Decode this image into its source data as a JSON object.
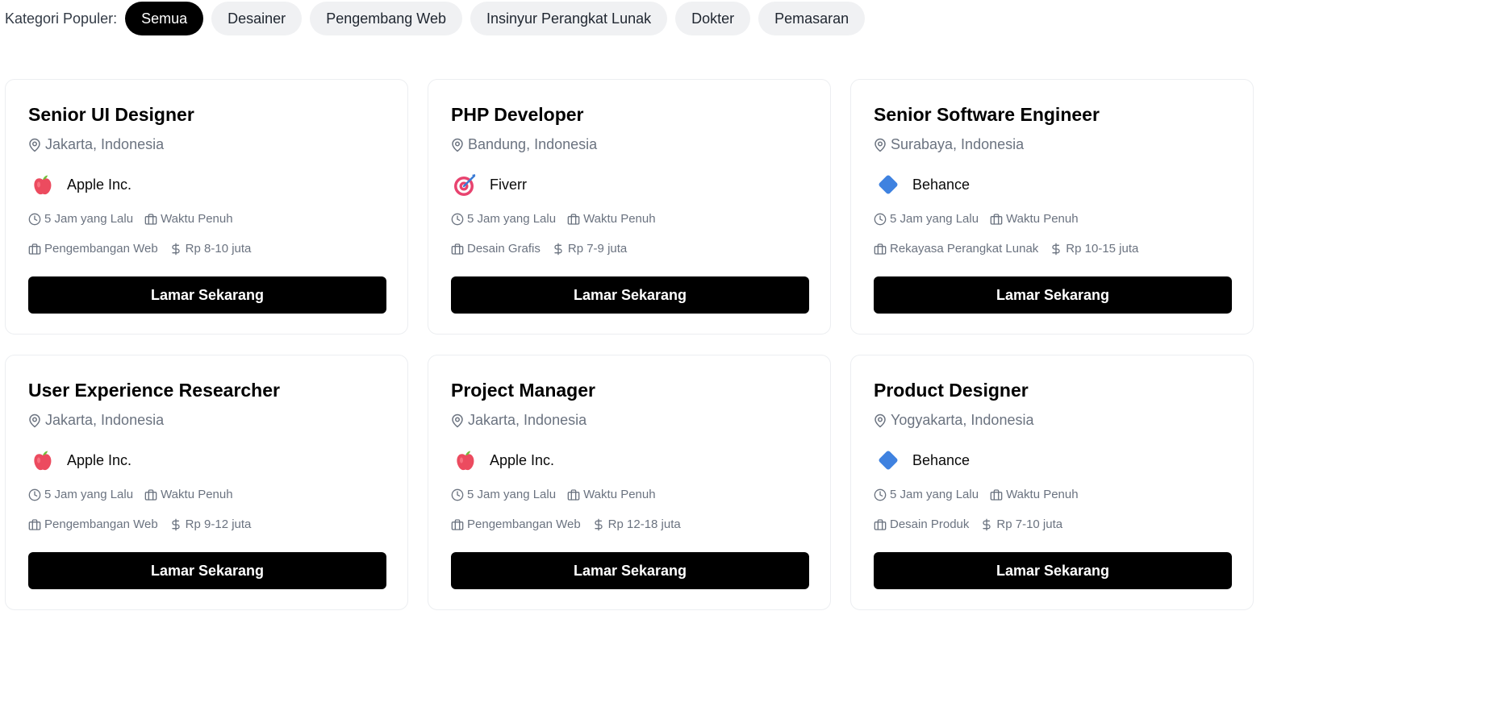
{
  "categories": {
    "label": "Kategori Populer:",
    "items": [
      "Semua",
      "Desainer",
      "Pengembang Web",
      "Insinyur Perangkat Lunak",
      "Dokter",
      "Pemasaran"
    ],
    "active": "Semua"
  },
  "jobs": [
    {
      "title": "Senior UI Designer",
      "location": "Jakarta, Indonesia",
      "company": "Apple Inc.",
      "logo": "apple-logo",
      "posted": "5 Jam yang Lalu",
      "type": "Waktu Penuh",
      "category": "Pengembangan Web",
      "salary": "Rp 8-10 juta",
      "apply": "Lamar Sekarang"
    },
    {
      "title": "PHP Developer",
      "location": "Bandung, Indonesia",
      "company": "Fiverr",
      "logo": "target-logo",
      "posted": "5 Jam yang Lalu",
      "type": "Waktu Penuh",
      "category": "Desain Grafis",
      "salary": "Rp 7-9 juta",
      "apply": "Lamar Sekarang"
    },
    {
      "title": "Senior Software Engineer",
      "location": "Surabaya, Indonesia",
      "company": "Behance",
      "logo": "diamond-logo",
      "posted": "5 Jam yang Lalu",
      "type": "Waktu Penuh",
      "category": "Rekayasa Perangkat Lunak",
      "salary": "Rp 10-15 juta",
      "apply": "Lamar Sekarang"
    },
    {
      "title": "User Experience Researcher",
      "location": "Jakarta, Indonesia",
      "company": "Apple Inc.",
      "logo": "apple-logo",
      "posted": "5 Jam yang Lalu",
      "type": "Waktu Penuh",
      "category": "Pengembangan Web",
      "salary": "Rp 9-12 juta",
      "apply": "Lamar Sekarang"
    },
    {
      "title": "Project Manager",
      "location": "Jakarta, Indonesia",
      "company": "Apple Inc.",
      "logo": "apple-logo",
      "posted": "5 Jam yang Lalu",
      "type": "Waktu Penuh",
      "category": "Pengembangan Web",
      "salary": "Rp 12-18 juta",
      "apply": "Lamar Sekarang"
    },
    {
      "title": "Product Designer",
      "location": "Yogyakarta, Indonesia",
      "company": "Behance",
      "logo": "diamond-logo",
      "posted": "5 Jam yang Lalu",
      "type": "Waktu Penuh",
      "category": "Desain Produk",
      "salary": "Rp 7-10 juta",
      "apply": "Lamar Sekarang"
    }
  ]
}
